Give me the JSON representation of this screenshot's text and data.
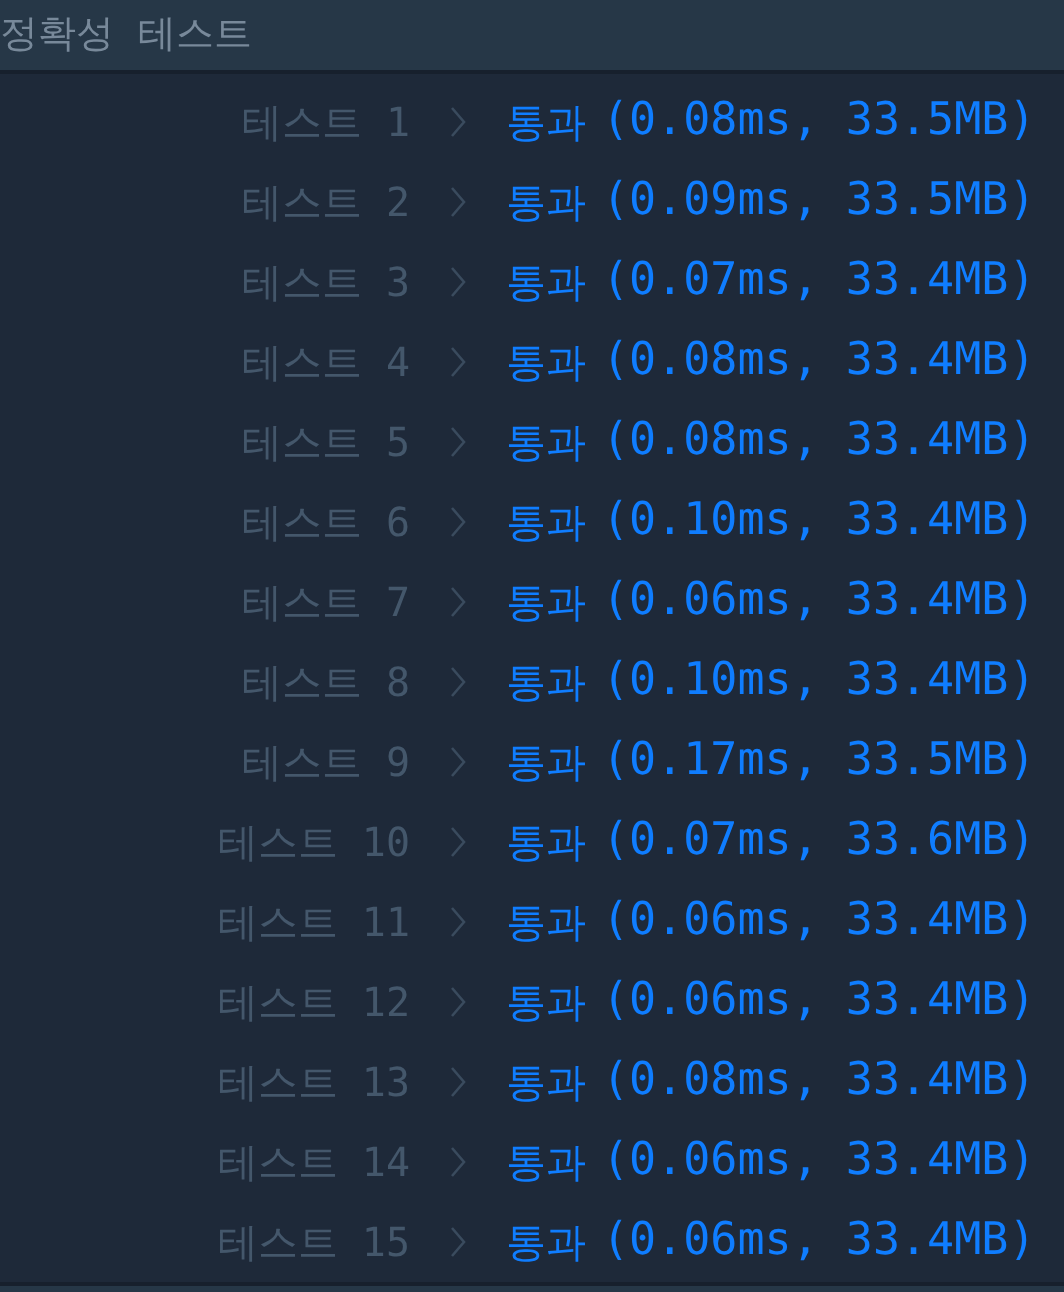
{
  "header": {
    "title": "정확성  테스트"
  },
  "results": [
    {
      "label": "테스트 1",
      "status": "통과",
      "passed": true,
      "detail": "(0.08ms, 33.5MB)"
    },
    {
      "label": "테스트 2",
      "status": "통과",
      "passed": true,
      "detail": "(0.09ms, 33.5MB)"
    },
    {
      "label": "테스트 3",
      "status": "통과",
      "passed": true,
      "detail": "(0.07ms, 33.4MB)"
    },
    {
      "label": "테스트 4",
      "status": "통과",
      "passed": true,
      "detail": "(0.08ms, 33.4MB)"
    },
    {
      "label": "테스트 5",
      "status": "통과",
      "passed": true,
      "detail": "(0.08ms, 33.4MB)"
    },
    {
      "label": "테스트 6",
      "status": "통과",
      "passed": true,
      "detail": "(0.10ms, 33.4MB)"
    },
    {
      "label": "테스트 7",
      "status": "통과",
      "passed": true,
      "detail": "(0.06ms, 33.4MB)"
    },
    {
      "label": "테스트 8",
      "status": "통과",
      "passed": true,
      "detail": "(0.10ms, 33.4MB)"
    },
    {
      "label": "테스트 9",
      "status": "통과",
      "passed": true,
      "detail": "(0.17ms, 33.5MB)"
    },
    {
      "label": "테스트 10",
      "status": "통과",
      "passed": true,
      "detail": "(0.07ms, 33.6MB)"
    },
    {
      "label": "테스트 11",
      "status": "통과",
      "passed": true,
      "detail": "(0.06ms, 33.4MB)"
    },
    {
      "label": "테스트 12",
      "status": "통과",
      "passed": true,
      "detail": "(0.06ms, 33.4MB)"
    },
    {
      "label": "테스트 13",
      "status": "통과",
      "passed": true,
      "detail": "(0.08ms, 33.4MB)"
    },
    {
      "label": "테스트 14",
      "status": "통과",
      "passed": true,
      "detail": "(0.06ms, 33.4MB)"
    },
    {
      "label": "테스트 15",
      "status": "통과",
      "passed": true,
      "detail": "(0.06ms, 33.4MB)"
    }
  ]
}
